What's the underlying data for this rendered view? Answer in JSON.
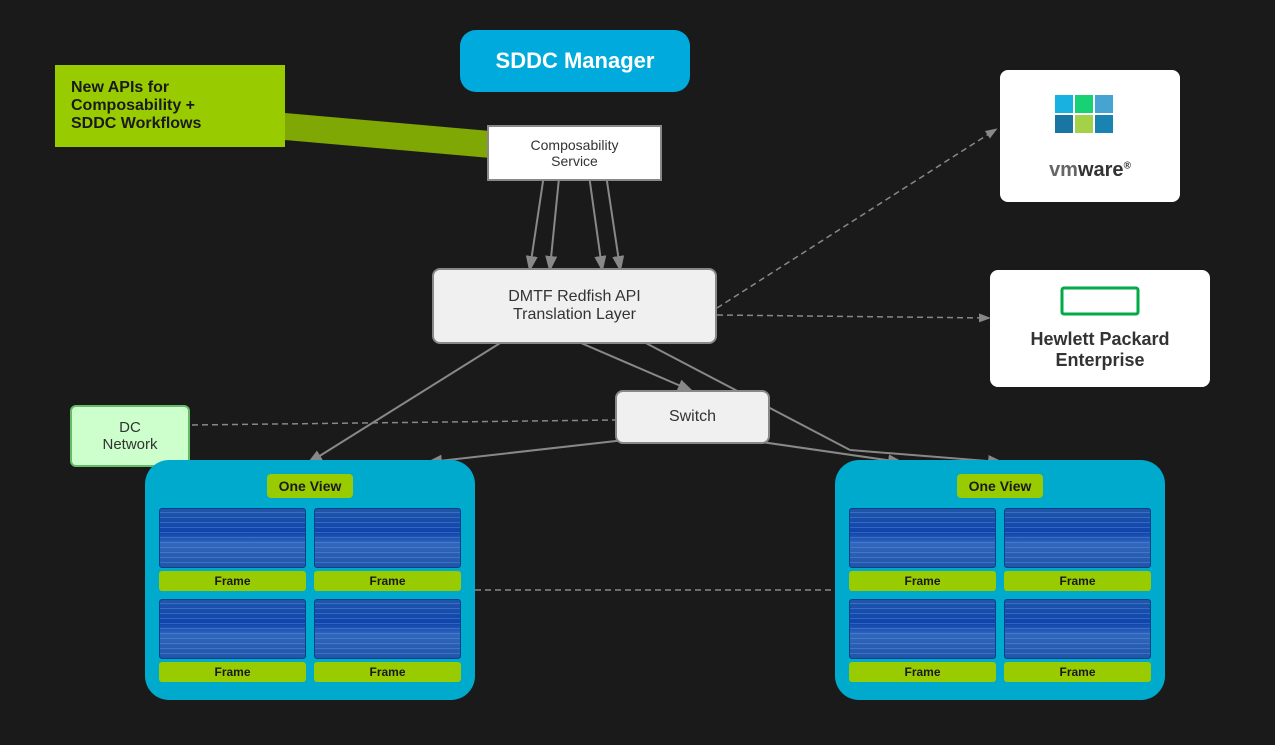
{
  "background": "#1a1a1a",
  "sddc_manager": {
    "label": "SDDC Manager"
  },
  "composability_service": {
    "label": "Composability\nService"
  },
  "new_apis": {
    "label": "New APIs for\nComposability +\nSDDC Workflows"
  },
  "dmtf": {
    "label": "DMTF Redfish API\nTranslation Layer"
  },
  "switch_box": {
    "label": "Switch"
  },
  "dc_network": {
    "label": "DC\nNetwork"
  },
  "vmware": {
    "label": "vmware®"
  },
  "hpe": {
    "label": "Hewlett Packard\nEnterprise"
  },
  "cluster_left": {
    "one_view": "One View",
    "frames": [
      "Frame",
      "Frame",
      "Frame",
      "Frame"
    ]
  },
  "cluster_right": {
    "one_view": "One View",
    "frames": [
      "Frame",
      "Frame",
      "Frame",
      "Frame"
    ]
  }
}
